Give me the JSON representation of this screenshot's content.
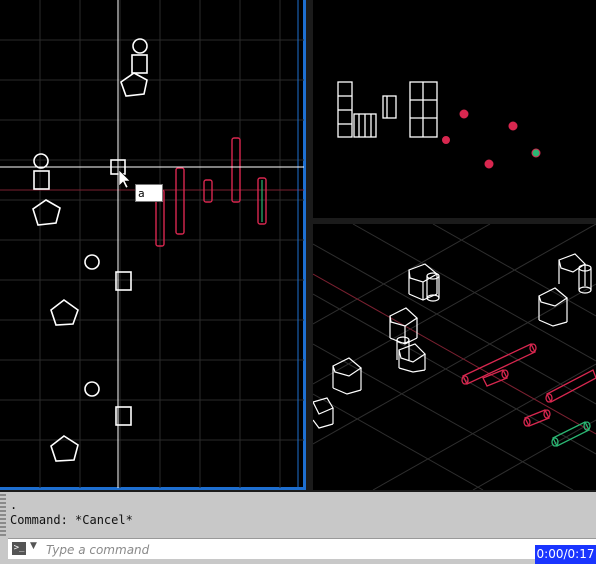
{
  "dynamic_input": {
    "value": "a"
  },
  "command_line": {
    "history": [
      ".",
      "Command: *Cancel*"
    ],
    "placeholder": "Type a command",
    "prompt_icon": "command-prompt-icon"
  },
  "recording_timer": {
    "text": "0:00/0:17"
  },
  "colors": {
    "viewport_background": "#000000",
    "active_viewport_border": "#1e6fd0",
    "wireframe": "#ffffff",
    "selected_red": "#d8274f",
    "selected_green": "#2bb673",
    "command_area_background": "#c8c8c8",
    "timer_background": "#1a35ff"
  }
}
